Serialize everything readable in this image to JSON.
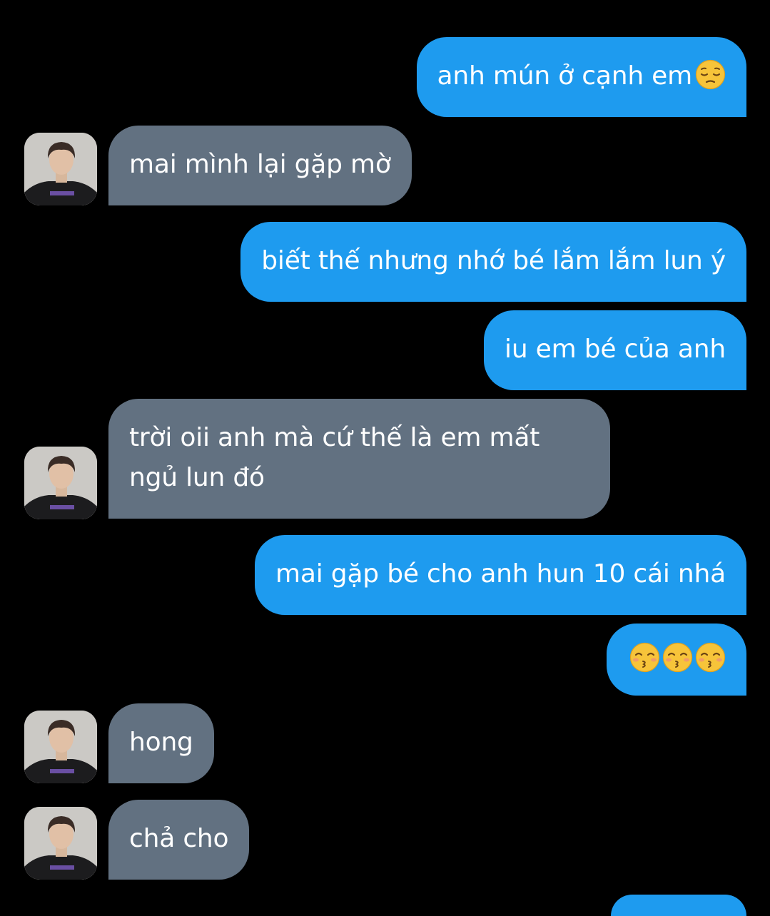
{
  "conversation": {
    "messages": [
      {
        "sender": "me",
        "text": "anh mún ở cạnh em",
        "emoji": [
          "pensive-face"
        ]
      },
      {
        "sender": "them",
        "text": "mai mình lại gặp mờ"
      },
      {
        "sender": "me",
        "text": "biết thế nhưng nhớ bé lắm lắm lun ý"
      },
      {
        "sender": "me",
        "text": "iu em bé của anh"
      },
      {
        "sender": "them",
        "text": "trời oii anh mà cứ thế là em mất ngủ lun đó"
      },
      {
        "sender": "me",
        "text": "mai gặp bé cho anh hun 10 cái nhá"
      },
      {
        "sender": "me",
        "text": "",
        "emoji": [
          "kissing-face-closed-eyes",
          "kissing-face-closed-eyes",
          "kissing-face-closed-eyes"
        ]
      },
      {
        "sender": "them",
        "text": "hong"
      },
      {
        "sender": "them",
        "text": "chả cho"
      }
    ]
  },
  "colors": {
    "background": "#000000",
    "sent_bubble": "#1e9bef",
    "received_bubble": "#627181",
    "text": "#ffffff"
  }
}
